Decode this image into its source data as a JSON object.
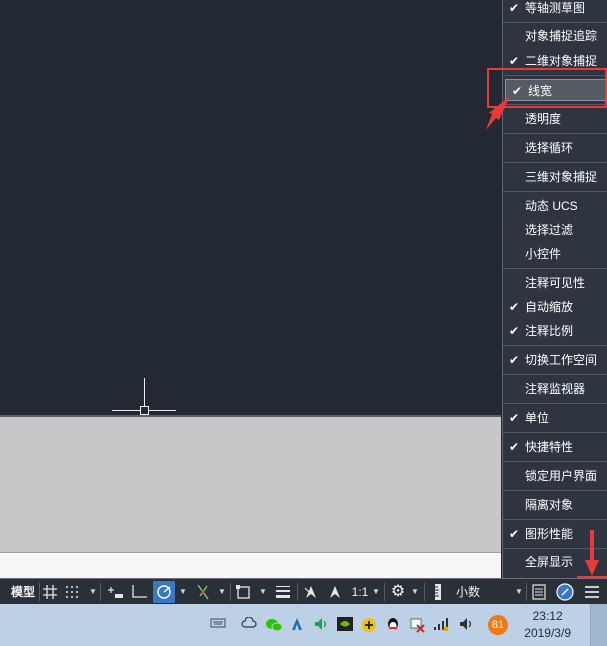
{
  "menu": {
    "items": [
      {
        "label": "等轴测草图",
        "checked": true
      },
      {
        "label": "对象捕捉追踪",
        "checked": false
      },
      {
        "label": "二维对象捕捉",
        "checked": true
      },
      {
        "label": "线宽",
        "checked": true,
        "highlight": true
      },
      {
        "label": "透明度",
        "checked": false
      },
      {
        "label": "选择循环",
        "checked": false
      },
      {
        "label": "三维对象捕捉",
        "checked": false
      },
      {
        "label": "动态 UCS",
        "checked": false
      },
      {
        "label": "选择过滤",
        "checked": false
      },
      {
        "label": "小控件",
        "checked": false
      },
      {
        "label": "注释可见性",
        "checked": false
      },
      {
        "label": "自动缩放",
        "checked": true
      },
      {
        "label": "注释比例",
        "checked": true
      },
      {
        "label": "切换工作空间",
        "checked": true
      },
      {
        "label": "注释监视器",
        "checked": false
      },
      {
        "label": "单位",
        "checked": true
      },
      {
        "label": "快捷特性",
        "checked": true
      },
      {
        "label": "锁定用户界面",
        "checked": false
      },
      {
        "label": "隔离对象",
        "checked": false
      },
      {
        "label": "图形性能",
        "checked": true
      },
      {
        "label": "全屏显示",
        "checked": false
      }
    ]
  },
  "statusbar": {
    "model_label": "模型",
    "scale_label": "1:1",
    "units_label": "小数"
  },
  "taskbar": {
    "badge": "81",
    "time": "23:12",
    "date": "2019/3/9"
  },
  "colors": {
    "annotation_red": "#e8393b",
    "accent_blue": "#3a78c4"
  }
}
